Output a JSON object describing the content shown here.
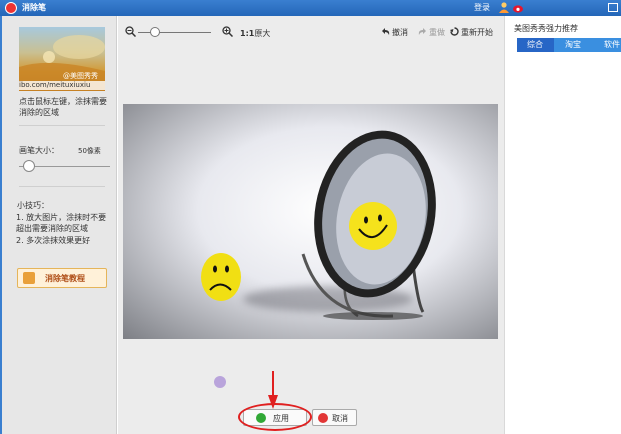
{
  "window": {
    "title": "消除笔",
    "login_label": "登录"
  },
  "left_panel": {
    "thumbnail_watermark_name": "@美图秀秀",
    "thumbnail_watermark_url": "ibo.com/meituxiuxiu",
    "description": "点击鼠标左键，涂抹需要消除的区域",
    "brush_size_label": "画笔大小：",
    "brush_size_value": "50像素",
    "brush_size_fraction": 0.05,
    "tips_title": "小技巧：",
    "tips": [
      "1. 放大图片，涂抹时不要超出需要消除的区域",
      "2. 多次涂抹效果更好"
    ],
    "tutorial_label": "消除笔教程"
  },
  "toolbar": {
    "original_size_prefix": "1:1",
    "original_size_label": "原大",
    "undo_label": "撤消",
    "redo_label": "重做",
    "restart_label": "重新开始"
  },
  "actions": {
    "apply_label": "应用",
    "cancel_label": "取消"
  },
  "right_panel": {
    "title": "美图秀秀强力推荐",
    "tabs": [
      {
        "label": "综合"
      },
      {
        "label": "淘宝"
      },
      {
        "label": "软件"
      }
    ]
  },
  "colors": {
    "title_bar": "#2466b8",
    "accent": "#3a8fe0",
    "highlight": "#e02020",
    "apply_icon": "#31a836",
    "cancel_icon": "#e23636"
  }
}
